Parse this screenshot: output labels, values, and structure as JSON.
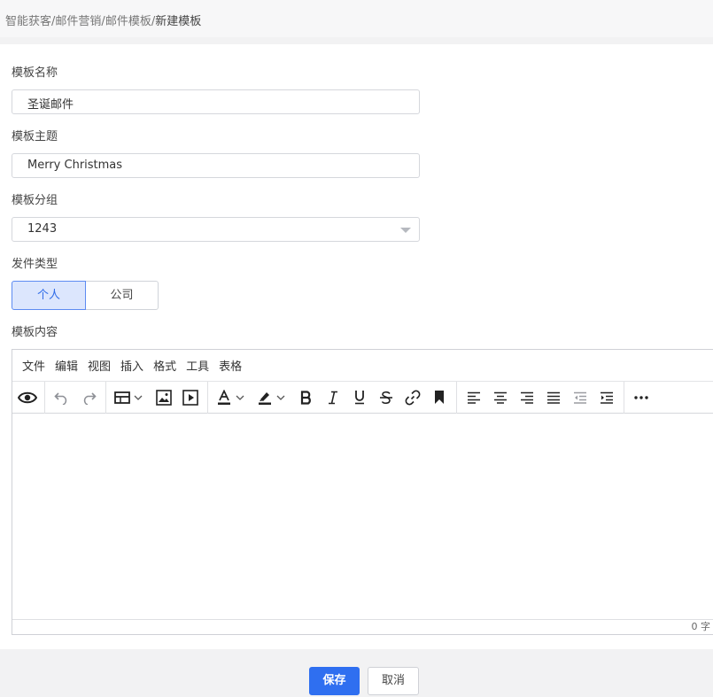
{
  "breadcrumb": {
    "parts": [
      "智能获客",
      "/",
      "邮件营销",
      "/",
      "邮件模板",
      "/"
    ],
    "current": "新建模板"
  },
  "form": {
    "name_label": "模板名称",
    "name_value": "圣诞邮件",
    "subject_label": "模板主题",
    "subject_value": "Merry Christmas",
    "group_label": "模板分组",
    "group_value": "1243",
    "send_type_label": "发件类型",
    "send_type_options": [
      "个人",
      "公司"
    ],
    "send_type_selected": "个人",
    "content_label": "模板内容"
  },
  "editor": {
    "menu": [
      "文件",
      "编辑",
      "视图",
      "插入",
      "格式",
      "工具",
      "表格"
    ],
    "toolbar_icons": [
      "eye-icon",
      "undo-icon",
      "redo-icon",
      "table-icon",
      "image-icon",
      "media-icon",
      "text-color-icon",
      "highlight-icon",
      "bold-icon",
      "italic-icon",
      "underline-icon",
      "strikethrough-icon",
      "link-icon",
      "bookmark-icon",
      "align-left-icon",
      "align-center-icon",
      "align-right-icon",
      "align-justify-icon",
      "outdent-icon",
      "indent-icon",
      "more-icon"
    ],
    "word_count": "0 字"
  },
  "actions": {
    "save": "保存",
    "cancel": "取消"
  },
  "colors": {
    "primary": "#2f6ff0",
    "selected_bg": "#dce6fd"
  }
}
